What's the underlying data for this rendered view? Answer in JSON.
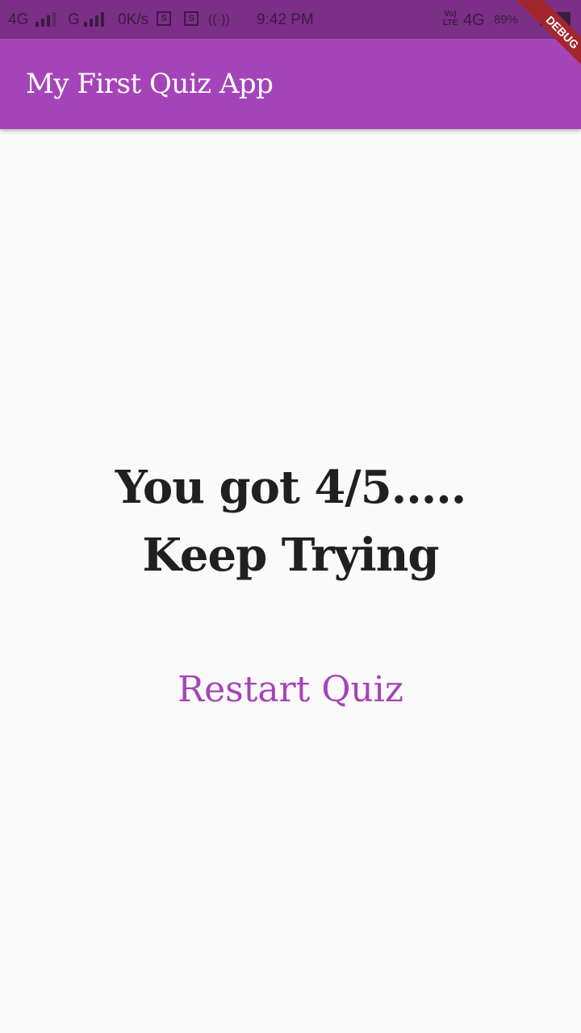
{
  "status_bar": {
    "network_1": "4G",
    "network_2": "G",
    "speed": "0K/s",
    "sim_icon_1": "S",
    "sim_icon_2": "S",
    "hotspot": "((·))",
    "time": "9:42 PM",
    "volte_top": "Vo)",
    "volte_bottom": "LTE",
    "network_right": "4G",
    "battery_percent": "89%"
  },
  "app_bar": {
    "title": "My First Quiz App"
  },
  "debug_banner": {
    "label": "DEBUG"
  },
  "result": {
    "line_1": "You got 4/5.....",
    "line_2": "Keep Trying"
  },
  "restart_button": {
    "label": "Restart Quiz"
  },
  "colors": {
    "primary": "#a544b8",
    "status_bar": "#7b2f86",
    "background": "#fafafa",
    "text": "#202020",
    "debug_ribbon": "#a1262e"
  }
}
